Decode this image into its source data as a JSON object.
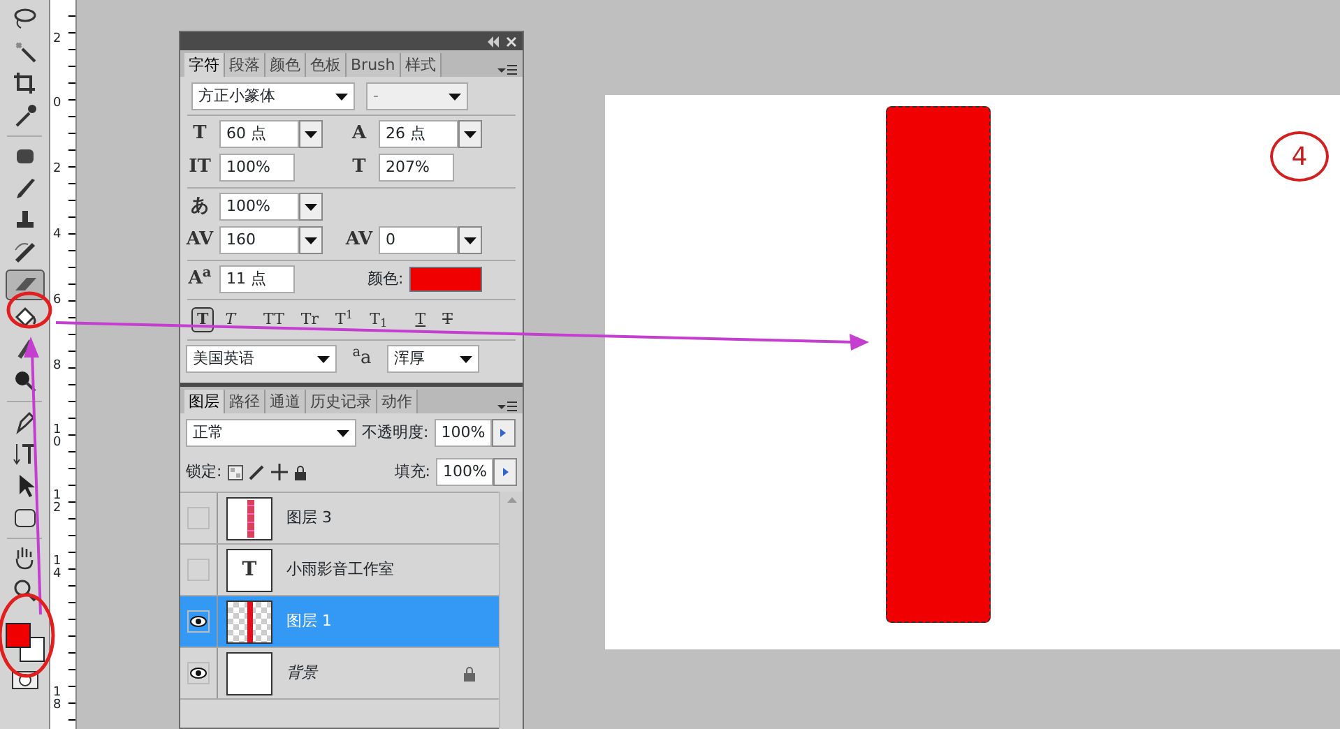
{
  "toolbar": {
    "tools": [
      {
        "kind": "lasso",
        "selected": false
      },
      {
        "kind": "wand",
        "selected": false
      },
      {
        "kind": "crop",
        "selected": false
      },
      {
        "kind": "eyedropper",
        "selected": false
      },
      {
        "kind": "healing",
        "selected": false
      },
      {
        "kind": "brush",
        "selected": false
      },
      {
        "kind": "stamp",
        "selected": false
      },
      {
        "kind": "history",
        "selected": false
      },
      {
        "kind": "eraser",
        "selected": true
      },
      {
        "kind": "bucket",
        "selected": false
      },
      {
        "kind": "smudge",
        "selected": false
      },
      {
        "kind": "dodge",
        "selected": false
      },
      {
        "kind": "pen",
        "selected": false
      },
      {
        "kind": "type",
        "selected": false
      },
      {
        "kind": "select",
        "selected": false
      },
      {
        "kind": "shape",
        "selected": false
      },
      {
        "kind": "hand",
        "selected": false
      },
      {
        "kind": "zoom",
        "selected": false
      }
    ],
    "swatches": [
      {
        "color": "#f00000"
      },
      {
        "color": "#ffffff"
      }
    ]
  },
  "ruler": {
    "labels": [
      "2",
      "0",
      "2",
      "4",
      "6",
      "8",
      "10",
      "12",
      "14",
      "18"
    ]
  },
  "character": {
    "tabs": [
      {
        "label": "字符",
        "selected": true
      },
      {
        "label": "段落",
        "selected": false
      },
      {
        "label": "颜色",
        "selected": false
      },
      {
        "label": "色板",
        "selected": false
      },
      {
        "label": "Brush",
        "selected": false
      },
      {
        "label": "样式",
        "selected": false
      }
    ],
    "font_family": "方正小篆体",
    "font_style": "-",
    "sections": [
      [
        [
          {
            "kind": "field",
            "glyph": "T",
            "value": "60 点",
            "dropdown": true
          },
          {
            "kind": "field",
            "glyph": "A",
            "value": "26 点",
            "dropdown": true
          }
        ],
        [
          {
            "kind": "field",
            "glyph": "IT",
            "value": "100%",
            "dropdown": false
          },
          {
            "kind": "field",
            "glyph": "T",
            "value": "207%",
            "dropdown": false
          }
        ]
      ],
      [
        [
          {
            "kind": "field",
            "glyph": "あ",
            "value": "100%",
            "dropdown": true
          }
        ],
        [
          {
            "kind": "field",
            "glyph": "AV",
            "value": "160",
            "dropdown": true
          },
          {
            "kind": "field",
            "glyph": "AV",
            "value": "0",
            "dropdown": true
          }
        ]
      ],
      [
        [
          {
            "kind": "field",
            "glyph": "A$^{a}$",
            "value": "11 点",
            "dropdown": false
          },
          {
            "kind": "color",
            "label": "颜色:",
            "color": "#f00000"
          }
        ]
      ]
    ],
    "styles": [
      {
        "kind": "bold",
        "label": "T",
        "selected": true
      },
      {
        "kind": "italic",
        "label": "T",
        "selected": false
      },
      {
        "kind": "caps",
        "label": "TT",
        "selected": false
      },
      {
        "kind": "smallcaps",
        "label": "Tr",
        "selected": false
      },
      {
        "kind": "super",
        "label": "T$^{1}$",
        "selected": false
      },
      {
        "kind": "sub",
        "label": "T$_{1}$",
        "selected": false
      },
      {
        "kind": "underline",
        "label": "T",
        "selected": false
      },
      {
        "kind": "strike",
        "label": "T",
        "selected": false
      }
    ],
    "language": "美国英语",
    "aa_glyph": "$^{a}$a",
    "antialias": "浑厚"
  },
  "layers": {
    "tabs": [
      {
        "label": "图层",
        "selected": true
      },
      {
        "label": "路径",
        "selected": false
      },
      {
        "label": "通道",
        "selected": false
      },
      {
        "label": "历史记录",
        "selected": false
      },
      {
        "label": "动作",
        "selected": false
      }
    ],
    "blend_mode": "正常",
    "opacity_label": "不透明度:",
    "opacity": "100%",
    "lock_label": "锁定:",
    "fill_label": "填充:",
    "fill": "100%",
    "items": [
      {
        "kind": "strip",
        "name": "图层 3",
        "visible": false,
        "selected": false,
        "locked": false
      },
      {
        "kind": "text",
        "name": "小雨影音工作室",
        "thumb_glyph": "T",
        "visible": false,
        "selected": false,
        "locked": false
      },
      {
        "kind": "bar",
        "name": "图层 1",
        "visible": true,
        "selected": true,
        "locked": false
      },
      {
        "kind": "background",
        "name": "背景",
        "visible": true,
        "selected": false,
        "locked": true
      }
    ]
  },
  "canvas": {
    "step_label": "4"
  }
}
